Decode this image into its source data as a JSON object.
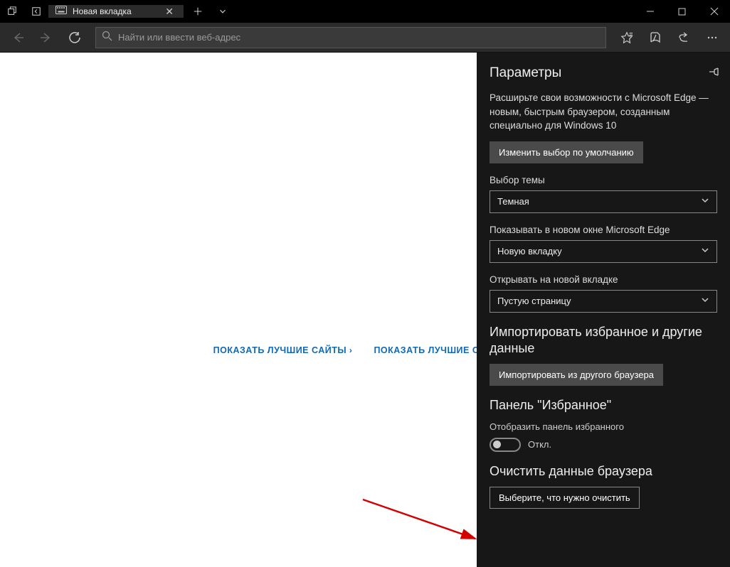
{
  "titlebar": {
    "tab_title": "Новая вкладка"
  },
  "toolbar": {
    "search_placeholder": "Найти или ввести веб-адрес"
  },
  "content": {
    "link_best_sites": "ПОКАЗАТЬ ЛУЧШИЕ САЙТЫ",
    "link_best_sites_feed": "ПОКАЗАТЬ ЛУЧШИЕ САЙТЫ И"
  },
  "panel": {
    "title": "Параметры",
    "promo_text": "Расширьте свои возможности с Microsoft Edge — новым, быстрым браузером, созданным специально для Windows 10",
    "change_default_btn": "Изменить выбор по умолчанию",
    "theme_label": "Выбор темы",
    "theme_value": "Темная",
    "open_with_label": "Показывать в новом окне Microsoft Edge",
    "open_with_value": "Новую вкладку",
    "new_tab_label": "Открывать на новой вкладке",
    "new_tab_value": "Пустую страницу",
    "import_heading": "Импортировать избранное и другие данные",
    "import_btn": "Импортировать из другого браузера",
    "fav_heading": "Панель \"Избранное\"",
    "fav_toggle_label": "Отобразить панель избранного",
    "fav_toggle_state": "Откл.",
    "clear_heading": "Очистить данные браузера",
    "clear_btn": "Выберите, что нужно очистить"
  }
}
